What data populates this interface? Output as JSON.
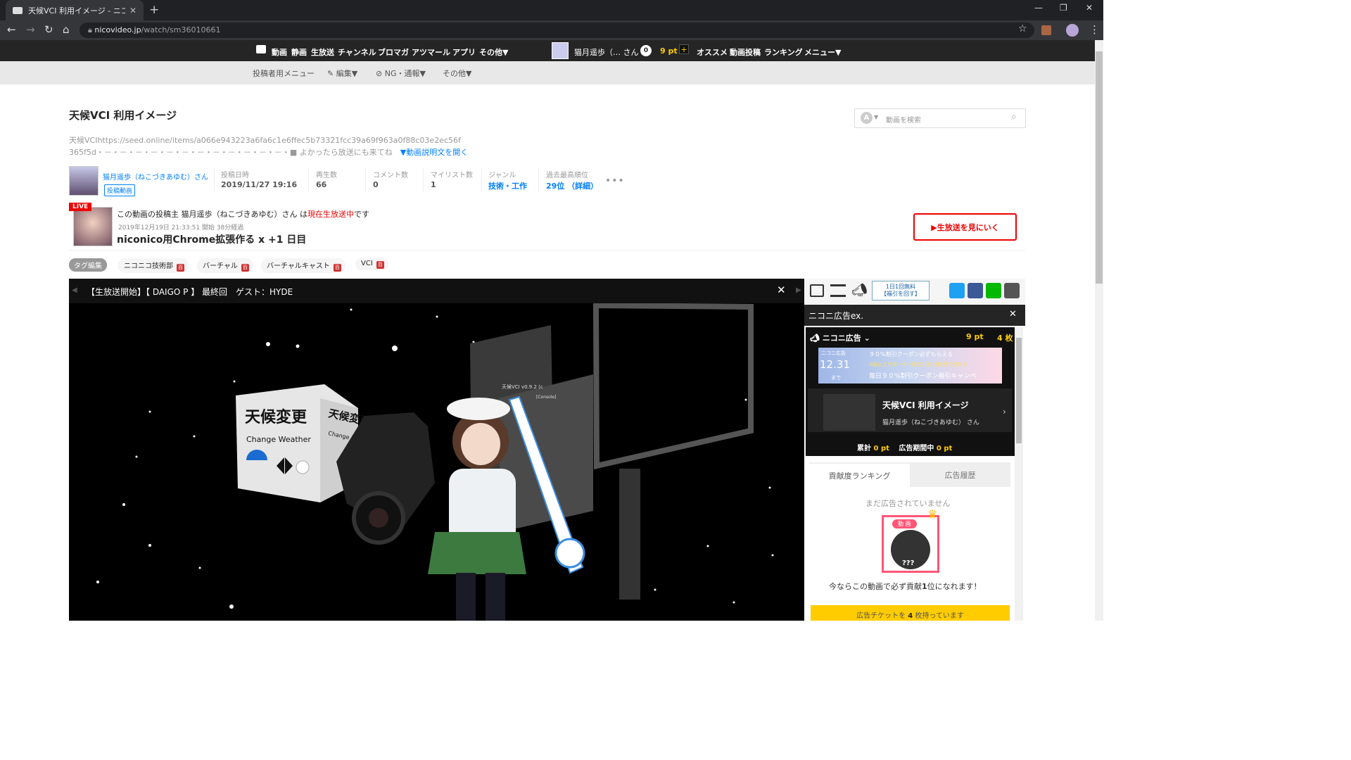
{
  "browser": {
    "tab_title": "天候VCI 利用イメージ - ニコニコ動画",
    "url_host": "nicovideo.jp",
    "url_path": "/watch/sm36010661",
    "tab_close": "✕",
    "new_tab": "+"
  },
  "nicobar": {
    "items": [
      "動画",
      "静画",
      "生放送",
      "チャンネル",
      "ブロマガ",
      "アツマール",
      "アプリ",
      "その他▼"
    ],
    "user": "猫月遥歩（… さん",
    "coin": "0",
    "points": "9 pt",
    "right_items": [
      "オススメ",
      "動画投稿",
      "ランキング",
      "メニュー▼"
    ]
  },
  "submenu": [
    "投稿者用メニュー",
    "編集▼",
    "NG・通報▼",
    "その他▼"
  ],
  "video": {
    "title": "天候VCI 利用イメージ",
    "search_placeholder": "動画を検索",
    "desc_line1": "天候VCIhttps://seed.online/items/a066e943223a6fa6c1e6ffec5b73321fcc39a69f963a0f88c03e2ec56f",
    "desc_line2": "365f5d・－・－・－・－・－・－・－・－・－・－・－・－・■ よかったら放送にも来てね",
    "desc_open": "▼動画説明文を開く",
    "uploader": "猫月遥歩（ねこづきあゆむ）さん",
    "uploader_tag": "投稿動画",
    "stats": [
      {
        "label": "投稿日時",
        "value": "2019/11/27 19:16"
      },
      {
        "label": "再生数",
        "value": "66"
      },
      {
        "label": "コメント数",
        "value": "0"
      },
      {
        "label": "マイリスト数",
        "value": "1"
      },
      {
        "label": "ジャンル",
        "value": "技術・工作"
      },
      {
        "label": "過去最高順位",
        "value": "29位 （詳細）"
      }
    ],
    "more": "•••"
  },
  "live": {
    "badge": "LIVE",
    "line1_pre": "この動画の投稿主 猫月遥歩（ねこづきあゆむ）さん は",
    "line1_red": "現在生放送中",
    "line1_post": "です",
    "time": "2019年12月19日 21:33:51 開始 38分経過",
    "title": "niconico用Chrome拡張作る x +1 日目",
    "button": "▶生放送を見にいく"
  },
  "tags": {
    "edit": "タグ編集",
    "items": [
      "ニコニコ技術部",
      "バーチャル",
      "バーチャルキャスト",
      "VCI"
    ],
    "icon": "百"
  },
  "player": {
    "ticker": "【生放送開始】【 DAIGO P 】 最終回　ゲスト：HYDE",
    "cube_text": "天候変更",
    "cube_sub": "Change Weather",
    "cube_side": "天候変更",
    "cube_side_sub": "Change Weather",
    "panel_title": "天候VCI v0.9.2 (c",
    "panel_console": "[Console]",
    "close": "✕"
  },
  "side": {
    "free_badge_1": "1日1回無料",
    "free_badge_2": "【福引を回す】",
    "ad_title": "ニコニ広告ex.",
    "ad_close": "✕",
    "ad_head": "ニコニ広告",
    "ad_points": "9 pt",
    "ad_tickets": "4 枚",
    "banner_label": "ニコニ広告",
    "banner_date": "12.31",
    "banner_until": "まで",
    "banner_line1": "９０%割引クーポン必ずもらえる",
    "banner_line2": "A級以上サポーター限定1日1回無料で回せる",
    "banner_line3": "毎日９０%割引クーポン福引キャンペ",
    "ad_video_title": "天候VCI 利用イメージ",
    "ad_video_user": "猫月遥歩（ねこづきあゆむ） さん",
    "total_label": "累計",
    "total_value": "0",
    "period_label": "広告期間中",
    "period_value": "0",
    "pt": "pt",
    "tab_rank": "貢献度ランキング",
    "tab_history": "広告履歴",
    "no_ads": "まだ広告されていません",
    "rank_badge": "動 画",
    "rank_unknown": "???",
    "rank_msg_pre": "今ならこの動画で必ず貢献",
    "rank_msg_num": "1",
    "rank_msg_post": "位になれます！",
    "ticket_pre": "広告チケットを",
    "ticket_num": "4",
    "ticket_post": "枚持っています"
  },
  "colors": {
    "accent_blue": "#0080ff",
    "live_red": "#ee0000",
    "nico_dark": "#252525",
    "ticket_yellow": "#ffcc00"
  }
}
